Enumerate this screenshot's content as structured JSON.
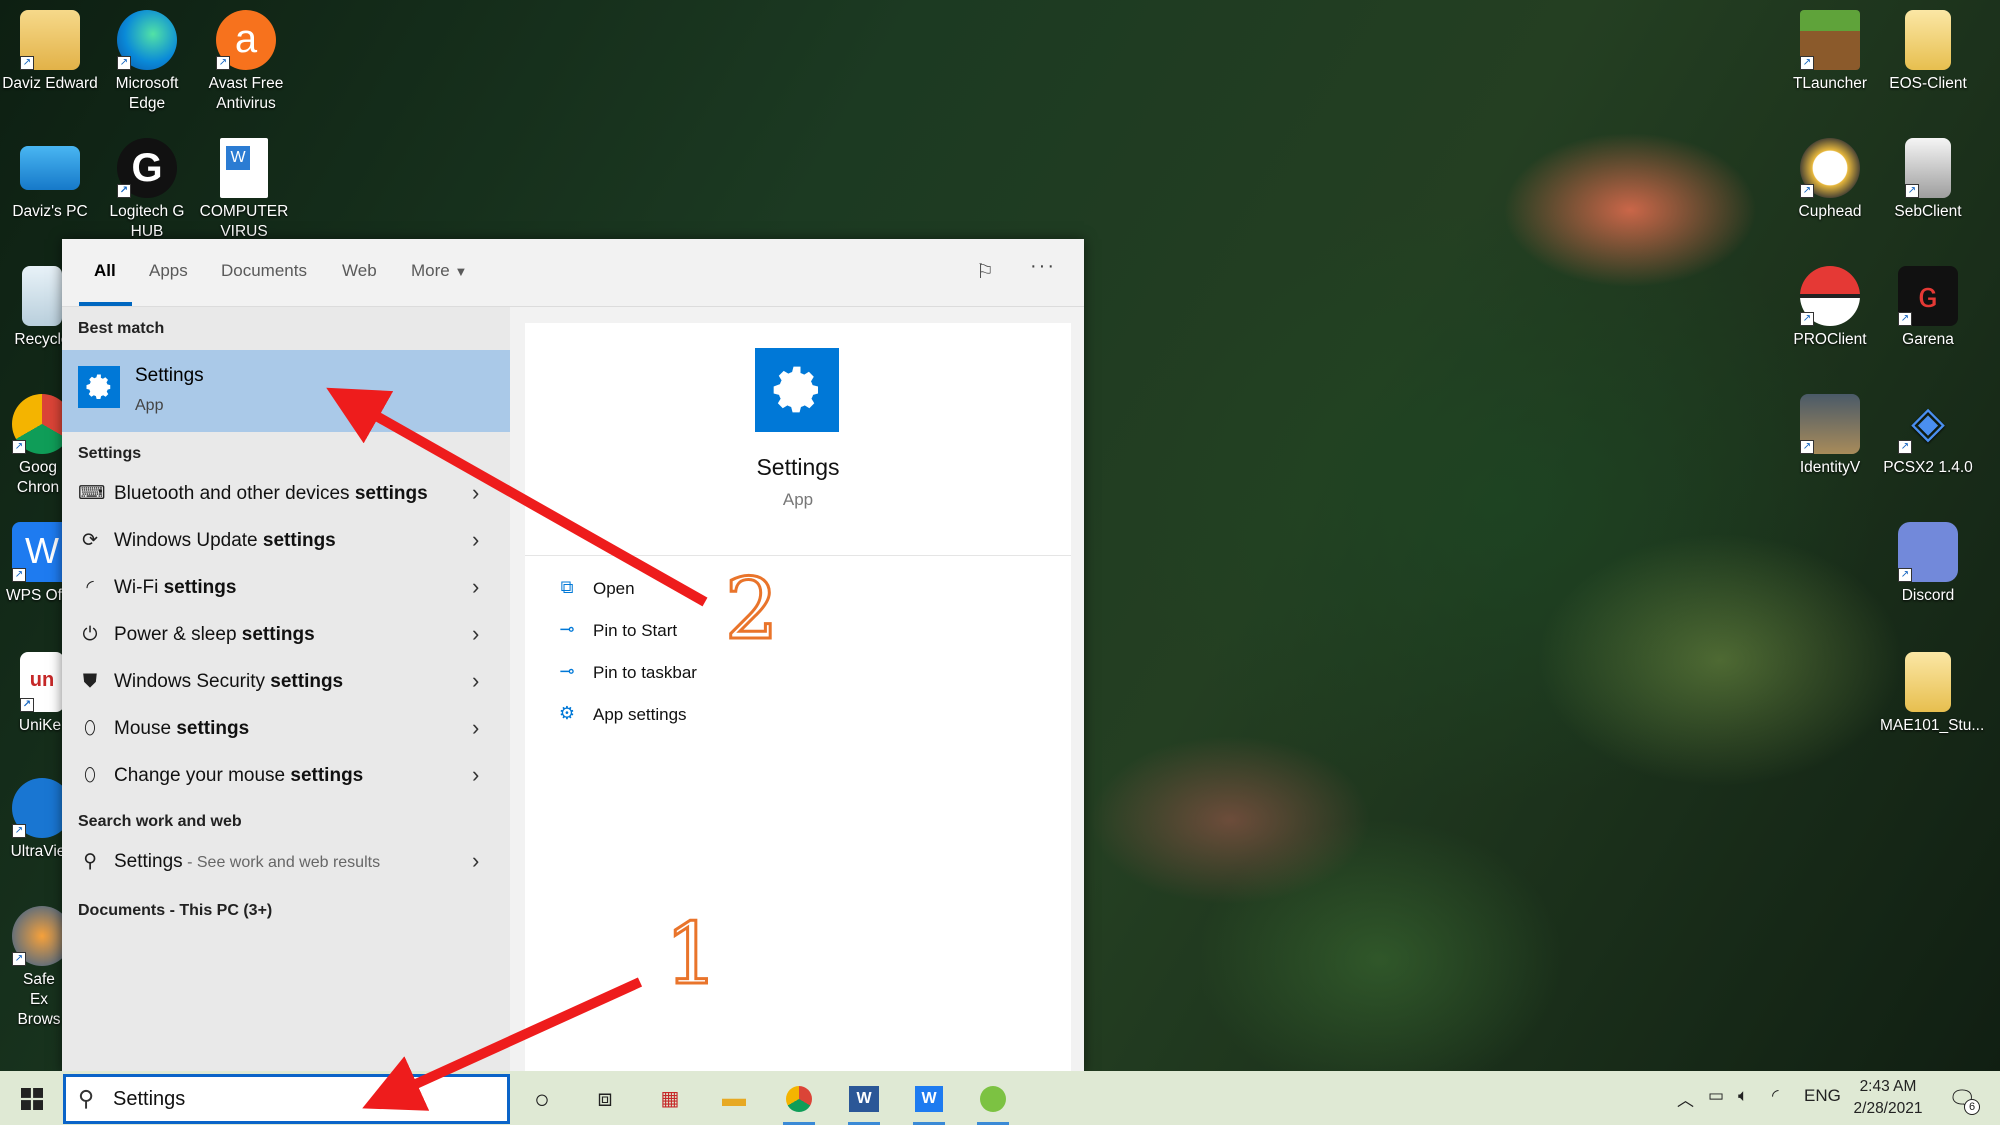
{
  "desktop": {
    "left_icons": [
      {
        "label": "Daviz Edward",
        "icon": "user-folder-icon"
      },
      {
        "label": "Microsoft Edge",
        "icon": "edge-icon"
      },
      {
        "label": "Avast Free Antivirus",
        "icon": "avast-icon"
      },
      {
        "label": "Daviz's PC",
        "icon": "this-pc-icon"
      },
      {
        "label": "Logitech G HUB",
        "icon": "logitech-icon"
      },
      {
        "label": "COMPUTER VIRUS",
        "icon": "word-doc-icon"
      },
      {
        "label": "Recycle",
        "icon": "recycle-bin-icon"
      },
      {
        "label": "Goog Chron",
        "icon": "chrome-icon"
      },
      {
        "label": "WPS Of",
        "icon": "wps-icon"
      },
      {
        "label": "UniKe",
        "icon": "unikey-icon"
      },
      {
        "label": "UltraVie",
        "icon": "ultraviewer-icon"
      },
      {
        "label": "Safe Ex Brows",
        "icon": "safe-exam-browser-icon"
      }
    ],
    "right_icons": [
      {
        "label": "TLauncher",
        "icon": "minecraft-icon"
      },
      {
        "label": "EOS-Client",
        "icon": "folder-icon"
      },
      {
        "label": "Cuphead",
        "icon": "cuphead-icon"
      },
      {
        "label": "SebClient",
        "icon": "file-icon"
      },
      {
        "label": "PROClient",
        "icon": "pokeball-icon"
      },
      {
        "label": "Garena",
        "icon": "garena-icon"
      },
      {
        "label": "IdentityV",
        "icon": "identityv-icon"
      },
      {
        "label": "PCSX2 1.4.0",
        "icon": "pcsx2-icon"
      },
      {
        "label": "Discord",
        "icon": "discord-icon"
      },
      {
        "label": "MAE101_Stu...",
        "icon": "folder-icon"
      }
    ]
  },
  "search": {
    "tabs": [
      "All",
      "Apps",
      "Documents",
      "Web",
      "More"
    ],
    "best_match_header": "Best match",
    "best_match": {
      "title": "Settings",
      "subtitle": "App"
    },
    "settings_header": "Settings",
    "settings_items": [
      {
        "pre": "Bluetooth and other devices ",
        "bold": "settings",
        "icon": "devices-icon"
      },
      {
        "pre": "Windows Update ",
        "bold": "settings",
        "icon": "update-icon"
      },
      {
        "pre": "Wi-Fi ",
        "bold": "settings",
        "icon": "wifi-icon"
      },
      {
        "pre": "Power & sleep ",
        "bold": "settings",
        "icon": "power-icon"
      },
      {
        "pre": "Windows Security ",
        "bold": "settings",
        "icon": "shield-icon"
      },
      {
        "pre": "Mouse ",
        "bold": "settings",
        "icon": "mouse-icon"
      },
      {
        "pre": "Change your mouse ",
        "bold": "settings",
        "icon": "mouse-icon"
      }
    ],
    "web_header": "Search work and web",
    "web_item": {
      "label": "Settings",
      "hint": " - See work and web results"
    },
    "documents_header": "Documents - This PC (3+)",
    "preview": {
      "title": "Settings",
      "subtitle": "App",
      "actions": [
        {
          "label": "Open",
          "icon": "open-icon"
        },
        {
          "label": "Pin to Start",
          "icon": "pin-icon"
        },
        {
          "label": "Pin to taskbar",
          "icon": "pin-icon"
        },
        {
          "label": "App settings",
          "icon": "gear-icon"
        }
      ]
    },
    "query": "Settings"
  },
  "taskbar": {
    "tray_lang": "ENG",
    "time": "2:43 AM",
    "date": "2/28/2021",
    "notification_count": "6"
  },
  "annotations": [
    "1",
    "2"
  ],
  "colors": {
    "accent": "#0078d7",
    "selected": "#aac9e8",
    "arrow": "#ee1c1c",
    "number": "#e9742b"
  }
}
